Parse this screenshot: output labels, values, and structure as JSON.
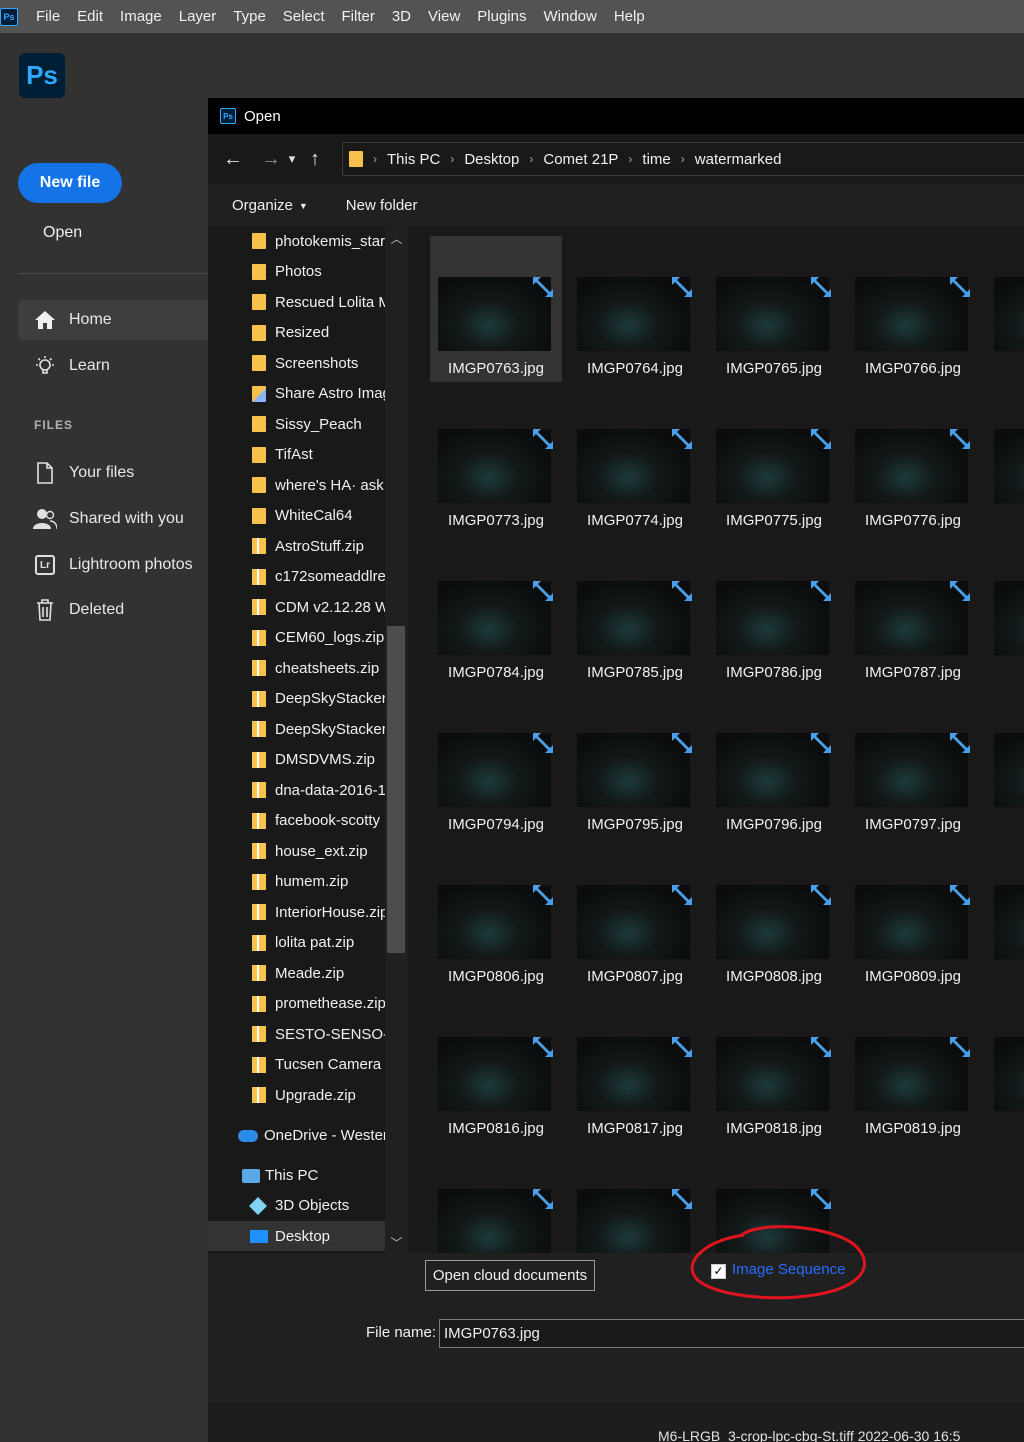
{
  "menubar": {
    "app_icon": "Ps",
    "items": [
      "File",
      "Edit",
      "Image",
      "Layer",
      "Type",
      "Select",
      "Filter",
      "3D",
      "View",
      "Plugins",
      "Window",
      "Help"
    ]
  },
  "home": {
    "logo": "Ps",
    "new_file_label": "New file",
    "open_label": "Open",
    "nav": [
      {
        "label": "Home",
        "icon": "home-icon"
      },
      {
        "label": "Learn",
        "icon": "lightbulb-icon"
      }
    ],
    "files_heading": "FILES",
    "files_nav": [
      {
        "label": "Your files",
        "icon": "document-icon"
      },
      {
        "label": "Shared with you",
        "icon": "people-icon"
      },
      {
        "label": "Lightroom photos",
        "icon": "lightroom-icon",
        "badge": "Lr"
      },
      {
        "label": "Deleted",
        "icon": "trash-icon"
      }
    ]
  },
  "dialog": {
    "title_icon": "Ps",
    "title": "Open",
    "breadcrumb": [
      "This PC",
      "Desktop",
      "Comet 21P",
      "time",
      "watermarked"
    ],
    "toolbar": {
      "organize": "Organize",
      "new_folder": "New folder"
    },
    "tree": [
      {
        "label": "photokemis_star",
        "kind": "folder"
      },
      {
        "label": "Photos",
        "kind": "folder"
      },
      {
        "label": "Rescued Lolita M",
        "kind": "folder"
      },
      {
        "label": "Resized",
        "kind": "folder"
      },
      {
        "label": "Screenshots",
        "kind": "folder"
      },
      {
        "label": "Share Astro Imag",
        "kind": "shared-folder"
      },
      {
        "label": "Sissy_Peach",
        "kind": "folder"
      },
      {
        "label": "TifAst",
        "kind": "folder"
      },
      {
        "label": "where's HA·  ask",
        "kind": "folder"
      },
      {
        "label": "WhiteCal64",
        "kind": "folder"
      },
      {
        "label": "AstroStuff.zip",
        "kind": "zip"
      },
      {
        "label": "c172someaddlre",
        "kind": "zip"
      },
      {
        "label": "CDM v2.12.28 W",
        "kind": "zip"
      },
      {
        "label": "CEM60_logs.zip",
        "kind": "zip"
      },
      {
        "label": "cheatsheets.zip",
        "kind": "zip"
      },
      {
        "label": "DeepSkyStacker6",
        "kind": "zip"
      },
      {
        "label": "DeepSkyStackerI",
        "kind": "zip"
      },
      {
        "label": "DMSDVMS.zip",
        "kind": "zip"
      },
      {
        "label": "dna-data-2016-1",
        "kind": "zip"
      },
      {
        "label": "facebook-scotty",
        "kind": "zip"
      },
      {
        "label": "house_ext.zip",
        "kind": "zip"
      },
      {
        "label": "humem.zip",
        "kind": "zip"
      },
      {
        "label": "InteriorHouse.zip",
        "kind": "zip"
      },
      {
        "label": "lolita pat.zip",
        "kind": "zip"
      },
      {
        "label": "Meade.zip",
        "kind": "zip"
      },
      {
        "label": "promethease.zip",
        "kind": "zip"
      },
      {
        "label": "SESTO-SENSO-2",
        "kind": "zip"
      },
      {
        "label": "Tucsen Camera D",
        "kind": "zip"
      },
      {
        "label": "Upgrade.zip",
        "kind": "zip"
      },
      {
        "label": "OneDrive - Wester",
        "kind": "onedrive"
      },
      {
        "label": "This PC",
        "kind": "pc"
      },
      {
        "label": "3D Objects",
        "kind": "3d"
      },
      {
        "label": "Desktop",
        "kind": "desktop"
      }
    ],
    "files": [
      [
        "IMGP0763.jpg",
        "IMGP0764.jpg",
        "IMGP0765.jpg",
        "IMGP0766.jpg",
        "IM"
      ],
      [
        "IMGP0773.jpg",
        "IMGP0774.jpg",
        "IMGP0775.jpg",
        "IMGP0776.jpg",
        "IM"
      ],
      [
        "IMGP0784.jpg",
        "IMGP0785.jpg",
        "IMGP0786.jpg",
        "IMGP0787.jpg",
        "IM"
      ],
      [
        "IMGP0794.jpg",
        "IMGP0795.jpg",
        "IMGP0796.jpg",
        "IMGP0797.jpg",
        "IM"
      ],
      [
        "IMGP0806.jpg",
        "IMGP0807.jpg",
        "IMGP0808.jpg",
        "IMGP0809.jpg",
        "IM"
      ],
      [
        "IMGP0816.jpg",
        "IMGP0817.jpg",
        "IMGP0818.jpg",
        "IMGP0819.jpg",
        "IM"
      ],
      [
        "",
        "",
        ""
      ]
    ],
    "open_cloud_label": "Open cloud documents",
    "image_sequence_label": "Image Sequence",
    "image_sequence_checked": true,
    "file_name_label": "File name:",
    "file_name_value": "IMGP0763.jpg",
    "accent_annotation_color": "#e0141e"
  },
  "background_text": "M6-LRGB_3-crop-lpc-cbg-St.tiff        2022-06-30 16:5"
}
